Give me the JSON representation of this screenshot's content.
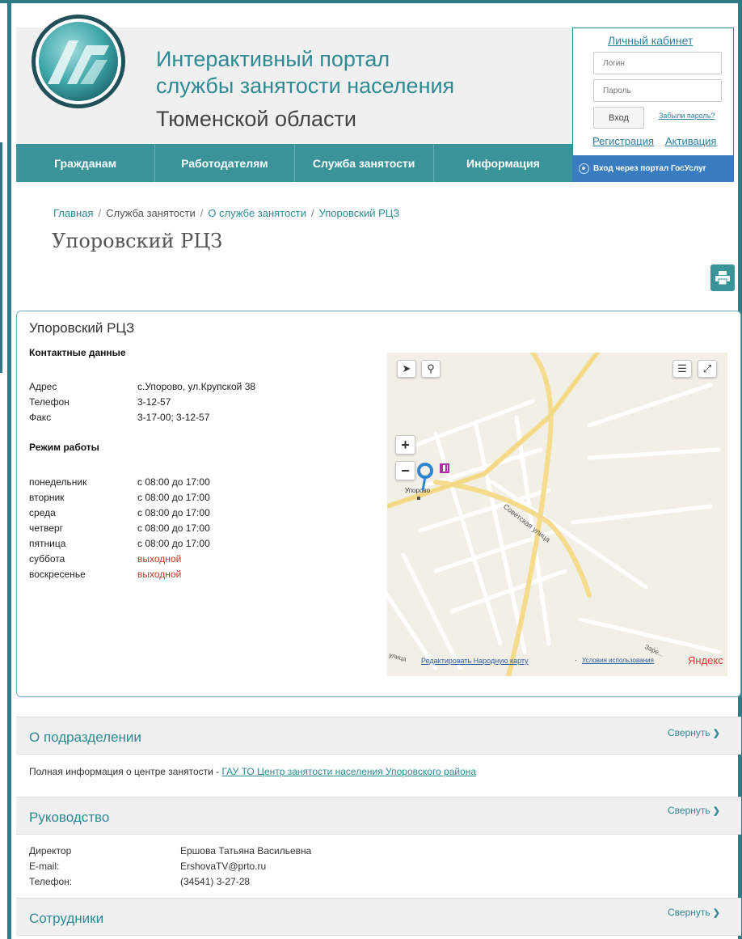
{
  "header": {
    "title_line1": "Интерактивный портал",
    "title_line2": "службы занятости населения",
    "title_line3": "Тюменской области"
  },
  "login": {
    "cabinet_link": "Личный кабинет",
    "login_placeholder": "Логин",
    "password_placeholder": "Пароль",
    "enter_button": "Вход",
    "forgot_link": "Забыли пароль?",
    "register_link": "Регистрация",
    "activate_link": "Активация",
    "gosuslugi_label": "Вход через портал ГосУслуг"
  },
  "nav": {
    "items": [
      "Гражданам",
      "Работодателям",
      "Служба занятости",
      "Информация"
    ]
  },
  "breadcrumb": {
    "items": [
      "Главная",
      "Служба занятости",
      "О службе занятости",
      "Упоровский РЦЗ"
    ]
  },
  "page_title": "Упоровский РЦЗ",
  "card": {
    "title": "Упоровский РЦЗ",
    "contacts_heading": "Контактные данные",
    "contacts": [
      {
        "label": "Адрес",
        "value": "с.Упорово, ул.Крупской 38"
      },
      {
        "label": "Телефон",
        "value": "3-12-57"
      },
      {
        "label": "Факс",
        "value": "3-17-00; 3-12-57"
      }
    ],
    "schedule_heading": "Режим работы",
    "schedule": [
      {
        "day": "понедельник",
        "hours": "с 08:00 до 17:00",
        "off": false
      },
      {
        "day": "вторник",
        "hours": "с 08:00 до 17:00",
        "off": false
      },
      {
        "day": "среда",
        "hours": "с 08:00 до 17:00",
        "off": false
      },
      {
        "day": "четверг",
        "hours": "с 08:00 до 17:00",
        "off": false
      },
      {
        "day": "пятница",
        "hours": "с 08:00 до 17:00",
        "off": false
      },
      {
        "day": "суббота",
        "hours": "выходной",
        "off": true
      },
      {
        "day": "воскресенье",
        "hours": "выходной",
        "off": true
      }
    ]
  },
  "map": {
    "place_label": "Упорово",
    "street_label": "Советская улица",
    "street_label_2": "Заре...",
    "street_label_3": "улица",
    "edit_link": "Редактировать Народную карту",
    "separator": "·",
    "terms_link": "Условия использования",
    "brand": "Яндекс"
  },
  "sections": {
    "about": {
      "title": "О подразделении",
      "toggle": "Свернуть",
      "text": "Полная информация о центре занятости - ",
      "link": "ГАУ ТО Центр занятости населения Упоровского района"
    },
    "management": {
      "title": "Руководство",
      "toggle": "Свернуть",
      "rows": [
        {
          "label": "Директор",
          "value": "Ершова Татьяна Васильевна"
        },
        {
          "label": "E-mail:",
          "value": "ErshovaTV@prto.ru"
        },
        {
          "label": "Телефон:",
          "value": "(34541) 3-27-28"
        }
      ]
    },
    "staff": {
      "title": "Сотрудники",
      "toggle": "Свернуть"
    }
  },
  "colors": {
    "accent": "#3a9399",
    "title_teal": "#2f8a93",
    "link_blue": "#2f7fa0",
    "gosuslugi_blue": "#3a7cc0",
    "off_red": "#c0392b"
  },
  "icons": [
    "logo-emblem",
    "gosuslugi-icon",
    "print-icon",
    "locate-icon",
    "search-icon",
    "layers-icon",
    "fullscreen-icon",
    "zoom-in-icon",
    "zoom-out-icon",
    "map-pin-icon",
    "chevron-down-icon"
  ]
}
